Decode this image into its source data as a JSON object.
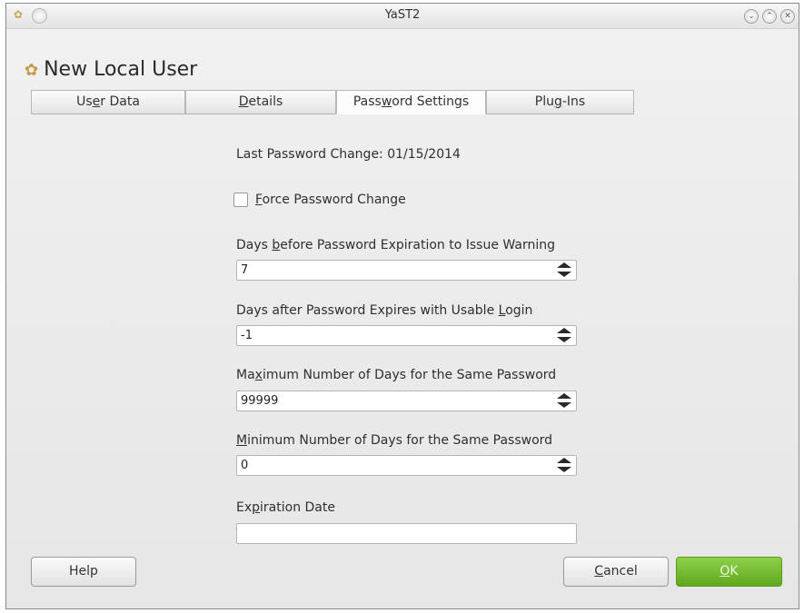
{
  "window": {
    "title": "YaST2"
  },
  "header": {
    "title": "New Local User",
    "icon": "users-icon"
  },
  "tabs": [
    {
      "pre": "Us",
      "acc": "e",
      "post": "r Data",
      "active": false
    },
    {
      "pre": "",
      "acc": "D",
      "post": "etails",
      "active": false
    },
    {
      "pre": "Pass",
      "acc": "w",
      "post": "ord Settings",
      "active": true
    },
    {
      "pre": "Plu",
      "acc": "g",
      "post": "-Ins",
      "active": false
    }
  ],
  "form": {
    "last_change": "Last Password Change: 01/15/2014",
    "force_change": {
      "pre": "",
      "acc": "F",
      "post": "orce Password Change",
      "checked": false
    },
    "warn_days": {
      "pre": "Days ",
      "acc": "b",
      "post": "efore Password Expiration to Issue Warning",
      "value": "7"
    },
    "inactive_days": {
      "pre": "Days after Password Expires with Usable ",
      "acc": "L",
      "post": "ogin",
      "value": "-1"
    },
    "max_days": {
      "pre": "Ma",
      "acc": "x",
      "post": "imum Number of Days for the Same Password",
      "value": "99999"
    },
    "min_days": {
      "pre": "",
      "acc": "M",
      "post": "inimum Number of Days for the Same Password",
      "value": "0"
    },
    "expiration": {
      "pre": "Ex",
      "acc": "p",
      "post": "iration Date",
      "value": ""
    }
  },
  "buttons": {
    "help": "Help",
    "cancel": {
      "pre": "",
      "acc": "C",
      "post": "ancel"
    },
    "ok": {
      "pre": "",
      "acc": "O",
      "post": "K"
    }
  },
  "colors": {
    "ok_button": "#6cb22a",
    "window_bg": "#ececec"
  }
}
